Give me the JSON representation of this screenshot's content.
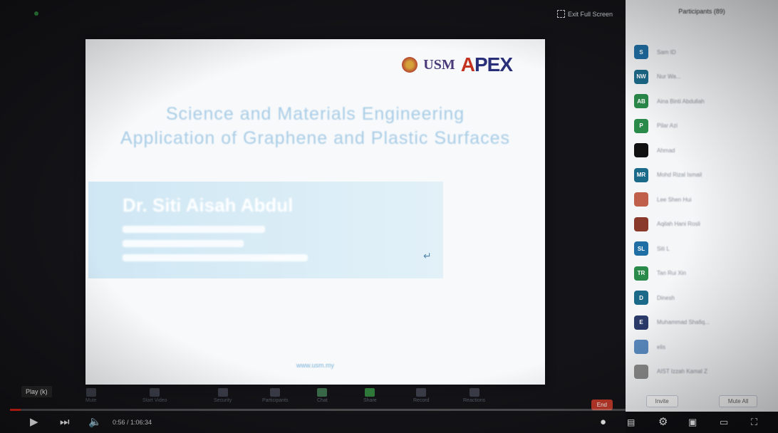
{
  "meeting": {
    "exit_fullscreen_label": "Exit Full Screen"
  },
  "slide": {
    "title_line1": "Science and Materials Engineering",
    "title_line2": "Application of Graphene and Plastic Surfaces",
    "speaker_name": "Dr. Siti Aisah Abdul",
    "footer_text": "www.usm.my"
  },
  "zoom_toolbar": {
    "tools": [
      "Mute",
      "Start Video",
      "Security",
      "Participants",
      "Chat",
      "Share",
      "Record",
      "Reactions"
    ],
    "end_label": "End"
  },
  "player": {
    "tooltip": "Play (k)",
    "time": "0:56 / 1:06:34",
    "progress_fraction": 0.014,
    "accent_color": "#e62117"
  },
  "participants": {
    "header": "Participants (89)",
    "items": [
      {
        "initials": "S",
        "name": "Sam ID",
        "color": "#1f6fa5"
      },
      {
        "initials": "NW",
        "name": "Nur Wa...",
        "color": "#1c6a8a"
      },
      {
        "initials": "AB",
        "name": "Aina Binti Abdullah",
        "color": "#2a8a4a"
      },
      {
        "initials": "P",
        "name": "Pilar Azi",
        "color": "#2a8a4a"
      },
      {
        "initials": "",
        "name": "Ahmad",
        "color": "#111111"
      },
      {
        "initials": "MR",
        "name": "Mohd Rizal Ismail",
        "color": "#1c6a8a"
      },
      {
        "initials": "",
        "name": "Lee Shen Hui",
        "color": "#c0604a"
      },
      {
        "initials": "",
        "name": "Aqilah Hani Rosli",
        "color": "#8a3a2a"
      },
      {
        "initials": "SL",
        "name": "Siti L",
        "color": "#1f6fa5"
      },
      {
        "initials": "TR",
        "name": "Tan Rui Xin",
        "color": "#2a8a4a"
      },
      {
        "initials": "D",
        "name": "Dinesh",
        "color": "#1c6a8a"
      },
      {
        "initials": "E",
        "name": "Muhammad Shafiq...",
        "color": "#2a3a6a"
      },
      {
        "initials": "",
        "name": "elis",
        "color": "#5a8ac0"
      },
      {
        "initials": "",
        "name": "AIST Izzah Kamal Z",
        "color": "#8a8a8a"
      }
    ],
    "invite_label": "Invite",
    "mute_all_label": "Mute All"
  }
}
